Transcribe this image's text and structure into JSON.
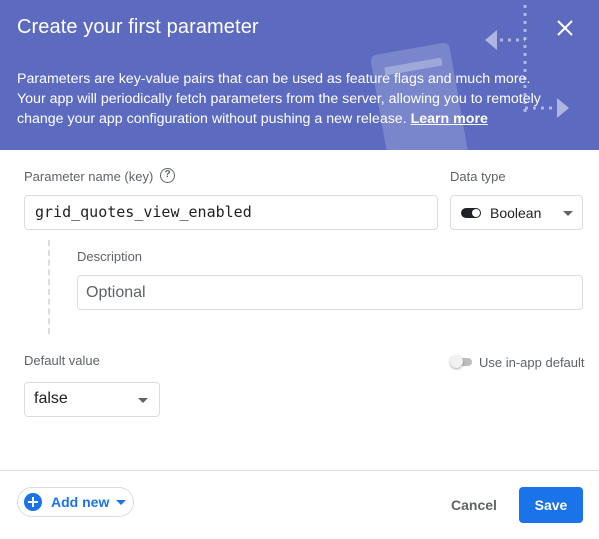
{
  "header": {
    "title": "Create your first parameter",
    "description": "Parameters are key-value pairs that can be used as feature flags and much more. Your app will periodically fetch parameters from the server, allowing you to remotely change your app configuration without pushing a new release.",
    "learn_more": "Learn more",
    "background_color": "#5c6bc0"
  },
  "form": {
    "key_label": "Parameter name (key)",
    "help_icon": "?",
    "key_value": "grid_quotes_view_enabled",
    "data_type_label": "Data type",
    "data_type_value": "Boolean",
    "description_label": "Description",
    "description_placeholder": "Optional",
    "default_value_label": "Default value",
    "default_value": "false",
    "use_in_app_default_label": "Use in-app default",
    "use_in_app_default_on": false
  },
  "footer": {
    "add_new_label": "Add new",
    "cancel_label": "Cancel",
    "save_label": "Save",
    "accent_color": "#1a73e8"
  },
  "icons": [
    "close-icon",
    "help-icon",
    "boolean-toggle-icon",
    "dropdown-arrow-icon",
    "add-circle-icon"
  ]
}
